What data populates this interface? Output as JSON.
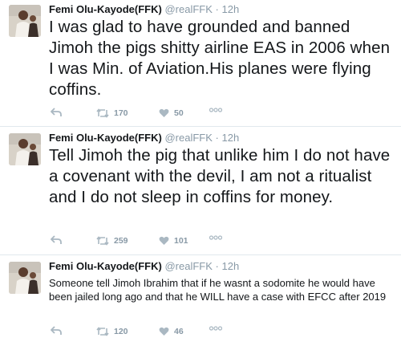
{
  "tweets": [
    {
      "name": "Femi Olu-Kayode(FFK)",
      "handle": "@realFFK",
      "separator": "·",
      "time": "12h",
      "text": "I was glad to have grounded and banned Jimoh the pigs shitty airline EAS in 2006 when I was Min. of Aviation.His planes were flying coffins.",
      "retweets": "170",
      "likes": "50",
      "icons": [
        "reply-icon",
        "retweet-icon",
        "like-icon",
        "more-icon"
      ]
    },
    {
      "name": "Femi Olu-Kayode(FFK)",
      "handle": "@realFFK",
      "separator": "·",
      "time": "12h",
      "text": "Tell Jimoh the pig that unlike  him I do not have a covenant with the devil, I am not a ritualist and I do not sleep in coffins for money.",
      "retweets": "259",
      "likes": "101",
      "icons": [
        "reply-icon",
        "retweet-icon",
        "like-icon",
        "more-icon"
      ]
    },
    {
      "name": "Femi Olu-Kayode(FFK)",
      "handle": "@realFFK",
      "separator": "·",
      "time": "12h",
      "text": "Someone tell Jimoh Ibrahim that if he wasnt a sodomite he would have been jailed long ago and that he WILL have a case with EFCC after 2019",
      "retweets": "120",
      "likes": "46",
      "icons": [
        "reply-icon",
        "retweet-icon",
        "like-icon",
        "more-icon"
      ]
    }
  ],
  "colors": {
    "name": "#14171a",
    "meta": "#8899a6",
    "icon": "#aab8c2",
    "divider": "#e1e8ed"
  }
}
